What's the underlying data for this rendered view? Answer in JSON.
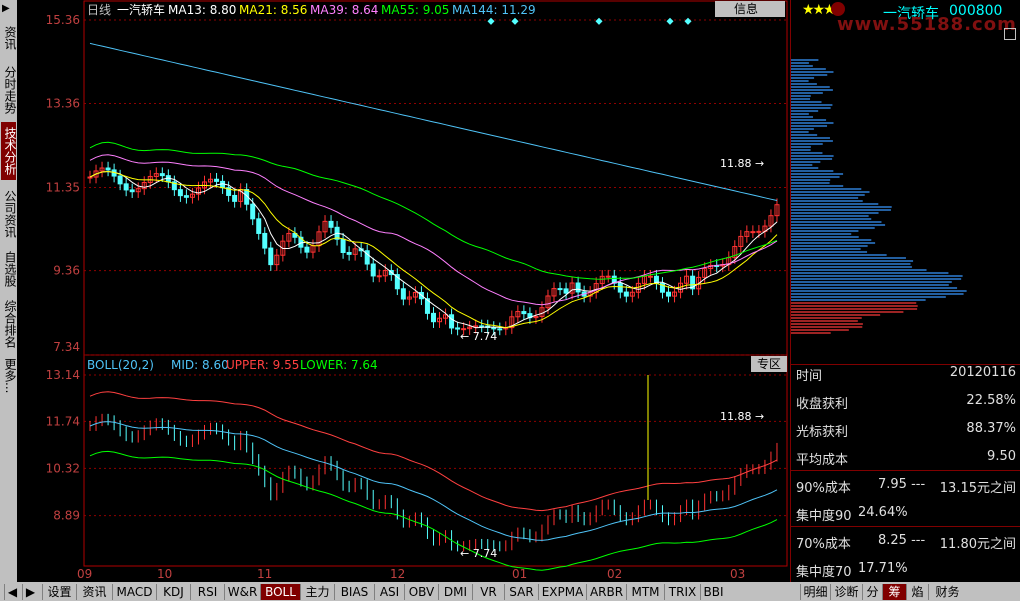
{
  "left_tabs": [
    {
      "label": "资讯",
      "active": false
    },
    {
      "label": "分时走势",
      "active": false
    },
    {
      "label": "技术分析",
      "active": true
    },
    {
      "label": "公司资讯",
      "active": false
    },
    {
      "label": "自选股",
      "active": false
    },
    {
      "label": "综合排名",
      "active": false
    },
    {
      "label": "更多...",
      "active": false
    }
  ],
  "main": {
    "header": {
      "period": "日线",
      "name": "一汽轿车",
      "ma13": "MA13: 8.80",
      "ma21": "MA21: 8.56",
      "ma39": "MA39: 8.64",
      "ma55": "MA55: 9.05",
      "ma144": "MA144: 11.29"
    },
    "info_button": "信息",
    "yticks": [
      "15.36",
      "13.36",
      "11.35",
      "9.36",
      "7.34"
    ],
    "high_label": "11.88",
    "low_label": "7.74"
  },
  "boll": {
    "header": {
      "name": "BOLL(20,2)",
      "mid": "MID: 8.60",
      "upper": "UPPER: 9.55",
      "lower": "LOWER: 7.64"
    },
    "zone_button": "专区",
    "yticks": [
      "13.14",
      "11.74",
      "10.32",
      "8.89"
    ],
    "high_label": "11.88",
    "low_label": "7.74"
  },
  "xaxis": {
    "labels": [
      "09",
      "10",
      "11",
      "12",
      "01",
      "02",
      "03"
    ]
  },
  "colors": {
    "up": "#ff3232",
    "down": "#54ffff",
    "ma13": "#ffffff",
    "ma21": "#ffff00",
    "ma39": "#ff80ff",
    "ma55": "#00ff00",
    "ma144": "#4fc3f7"
  },
  "right": {
    "stars": "★★★",
    "name": "一汽轿车",
    "code": "000800",
    "watermark": "www.55188.com",
    "rows": [
      {
        "label": "时间",
        "value": "20120116"
      },
      {
        "label": "收盘获利",
        "value": "22.58%"
      },
      {
        "label": "光标获利",
        "value": "88.37%"
      },
      {
        "label": "平均成本",
        "value": "9.50"
      }
    ],
    "cost90": {
      "label": "90%成本",
      "low": "7.95 ---",
      "high": "13.15元之间"
    },
    "conc90": {
      "label": "集中度90",
      "value": "24.64%"
    },
    "cost70": {
      "label": "70%成本",
      "low": "8.25 ---",
      "high": "11.80元之间"
    },
    "conc70": {
      "label": "集中度70",
      "value": "17.71%"
    }
  },
  "bottom_tabs": [
    "设置",
    "资讯",
    "MACD",
    "KDJ",
    "RSI",
    "W&R",
    "BOLL",
    "主力",
    "BIAS",
    "ASI",
    "OBV",
    "DMI",
    "VR",
    "SAR",
    "EXPMA",
    "ARBR",
    "MTM",
    "TRIX",
    "BBI"
  ],
  "bottom_active": "BOLL",
  "bottom_right_tabs": [
    "明细",
    "诊断",
    "分",
    "筹",
    "焰",
    "财务"
  ],
  "bottom_right_active": "筹"
}
